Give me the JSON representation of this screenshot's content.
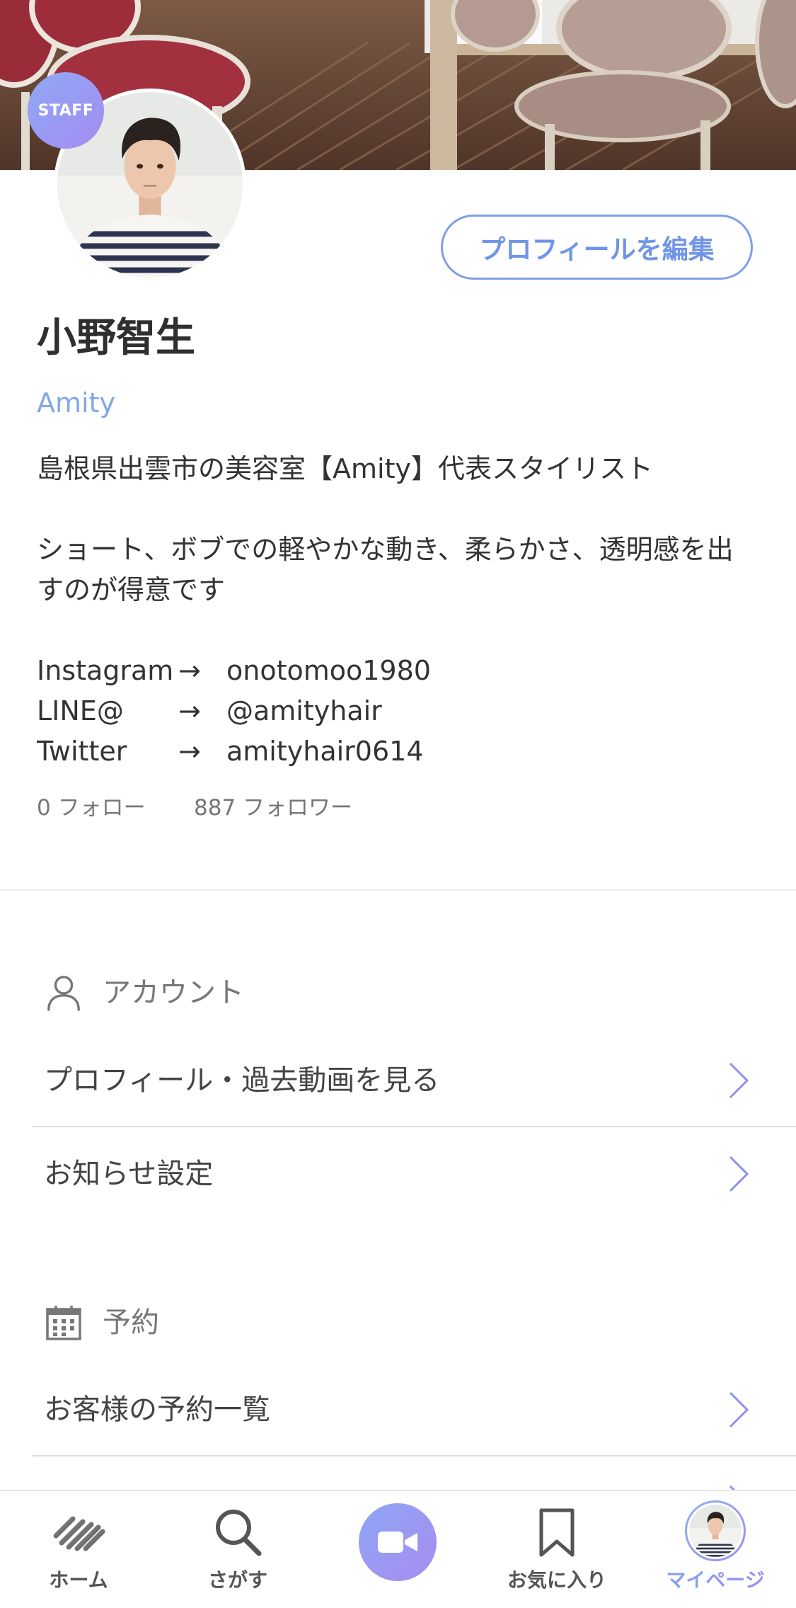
{
  "profile": {
    "staff_badge": "STAFF",
    "edit_button": "プロフィールを編集",
    "name": "小野智生",
    "salon": "Amity",
    "bio_lines": [
      "島根県出雲市の美容室【Amity】代表スタイリスト",
      "ショート、ボブでの軽やかな動き、柔らかさ、透明感を出",
      "すのが得意です"
    ],
    "social": [
      {
        "label": "Instagram",
        "arrow": "→",
        "handle": "onotomoo1980"
      },
      {
        "label": "LINE@",
        "arrow": "→",
        "handle": "@amityhair"
      },
      {
        "label": "Twitter",
        "arrow": "→",
        "handle": "amityhair0614"
      }
    ],
    "follow_count": "0",
    "follow_label": "フォロー",
    "follower_count": "887",
    "follower_label": "フォロワー"
  },
  "sections": [
    {
      "title": "アカウント",
      "icon": "person-icon",
      "items": [
        {
          "label": "プロフィール・過去動画を見る",
          "icon": "chevron-right-icon"
        },
        {
          "label": "お知らせ設定",
          "icon": "chevron-right-icon"
        }
      ]
    },
    {
      "title": "予約",
      "icon": "calendar-icon",
      "items": [
        {
          "label": "お客様の予約一覧",
          "icon": "chevron-right-icon"
        }
      ]
    }
  ],
  "bottom_nav": {
    "items": [
      {
        "label": "ホーム",
        "icon": "home-logo-icon",
        "active": false
      },
      {
        "label": "さがす",
        "icon": "search-icon",
        "active": false
      },
      {
        "label": "お気に入り",
        "icon": "bookmark-icon",
        "active": false
      },
      {
        "label": "マイページ",
        "icon": "avatar-icon",
        "active": true
      }
    ],
    "center_action": {
      "icon": "video-camera-icon"
    }
  },
  "colors": {
    "accent": "#7f9ee9",
    "salon_link": "#82a7e8",
    "chevron": "#8e8ff0",
    "gradient_start": "#8fa9f3",
    "gradient_end": "#a38cf1",
    "text": "#333333",
    "muted": "#777777"
  }
}
